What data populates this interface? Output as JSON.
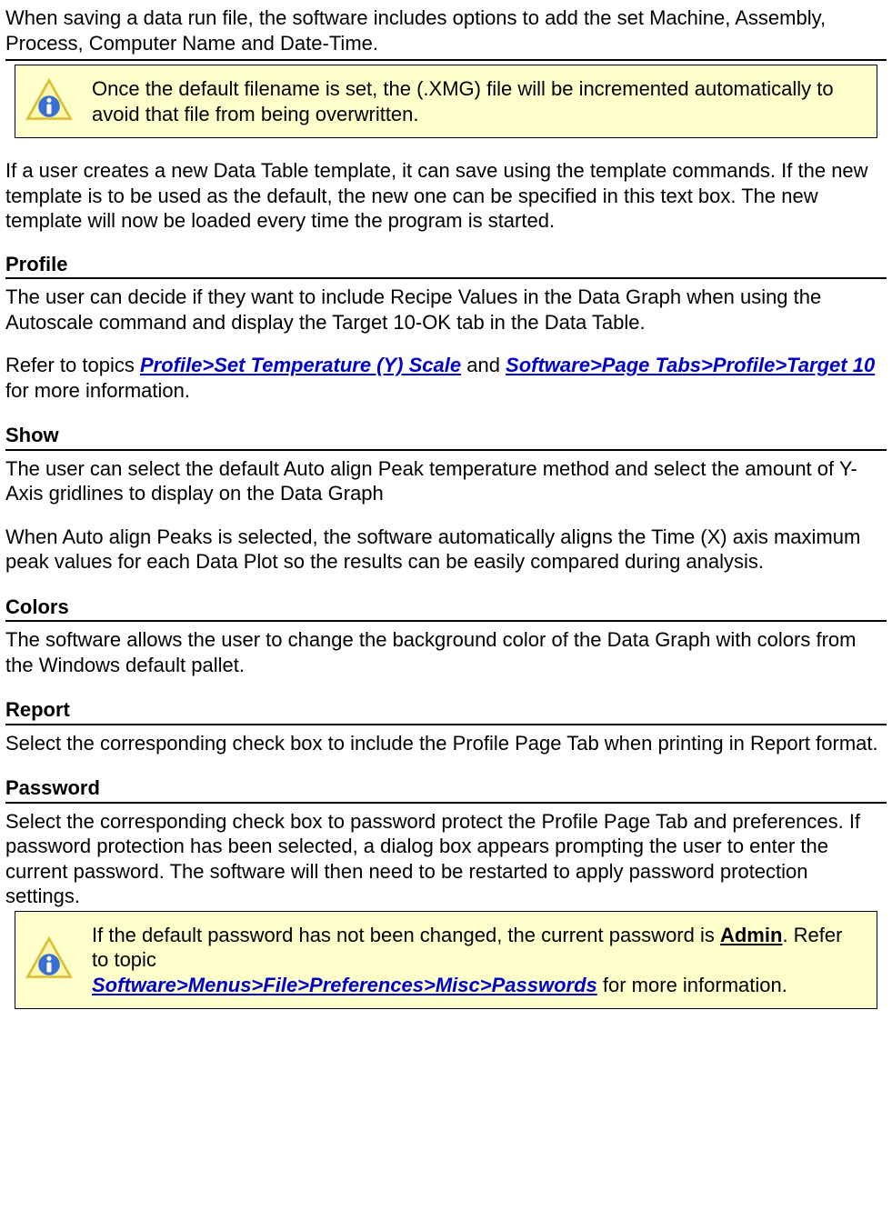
{
  "intro": "When saving a data run file, the software includes options to add the set Machine, Assembly, Process, Computer Name and Date-Time.",
  "info1": "Once the default filename is set, the (.XMG) file will be incremented automatically to avoid that file from being overwritten.",
  "template_para": "If a user creates a new Data Table template, it can save using the template commands. If the new template is to be used as the default, the new one can be specified in this text box. The new template will now be loaded every time the program is started.",
  "profile": {
    "heading": "Profile",
    "p1": "The user can decide if they want to include Recipe Values in the Data Graph when using the Autoscale command and display the Target 10-OK tab in the Data Table.",
    "refer_prefix": "Refer to topics ",
    "link1": "Profile>Set Temperature (Y) Scale",
    "mid": " and   ",
    "link2": "Software>Page Tabs>Profile>Target 10",
    "suffix": " for more information."
  },
  "show": {
    "heading": "Show",
    "p1": "The user can select the default Auto align Peak temperature method and select the amount of Y-Axis gridlines to display on the Data Graph",
    "p2": "When Auto align Peaks is selected, the software automatically aligns the Time (X) axis maximum peak values for each Data Plot so the results can be easily compared during analysis."
  },
  "colors": {
    "heading": "Colors",
    "p1": "The software allows the user to change the background color of the Data Graph with colors from the Windows default pallet."
  },
  "report": {
    "heading": "Report",
    "p1": "Select the corresponding check box to include the Profile Page Tab when printing in Report format."
  },
  "password": {
    "heading": "Password",
    "p1": "Select the corresponding check box to password protect the Profile Page Tab and preferences. If password protection has been selected, a dialog box appears prompting the user to enter the current password. The software will then need to be restarted to apply password protection settings."
  },
  "info2": {
    "pre": "If the default password has not been changed, the current password is ",
    "pw": "Admin",
    "mid": ". Refer to topic ",
    "link": "Software>Menus>File>Preferences>Misc>Passwords",
    "post": " for more information."
  }
}
